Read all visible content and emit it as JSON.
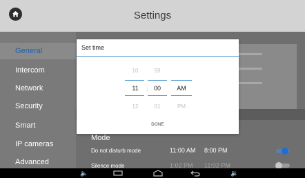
{
  "header": {
    "title": "Settings",
    "home_icon": "home-icon"
  },
  "sidebar": {
    "items": [
      {
        "label": "General",
        "active": true
      },
      {
        "label": "Intercom",
        "active": false
      },
      {
        "label": "Network",
        "active": false
      },
      {
        "label": "Security",
        "active": false
      },
      {
        "label": "Smart",
        "active": false
      },
      {
        "label": "IP cameras",
        "active": false
      },
      {
        "label": "Advanced",
        "active": false
      }
    ]
  },
  "mode": {
    "header": "Mode",
    "rows": [
      {
        "label": "Do not disturb mode",
        "start": "11:00 AM",
        "end": "8:00 PM",
        "enabled": true
      },
      {
        "label": "Silence mode",
        "start": "1:02 PM",
        "end": "11:02 PM",
        "enabled": false
      }
    ]
  },
  "dialog": {
    "title": "Set time",
    "hour": {
      "prev": "10",
      "current": "11",
      "next": "12"
    },
    "minute": {
      "prev": "59",
      "current": "00",
      "next": "01"
    },
    "ampm": {
      "current": "AM",
      "next": "PM"
    },
    "separator": ":",
    "done_label": "DONE"
  },
  "navbar": {
    "icons": [
      "volume-down-icon",
      "recent-apps-icon",
      "home-nav-icon",
      "back-icon",
      "volume-up-icon"
    ]
  },
  "colors": {
    "accent": "#1e5fa8",
    "toggle_on": "#1e6fd0",
    "picker_line": "#5aa0d0"
  }
}
